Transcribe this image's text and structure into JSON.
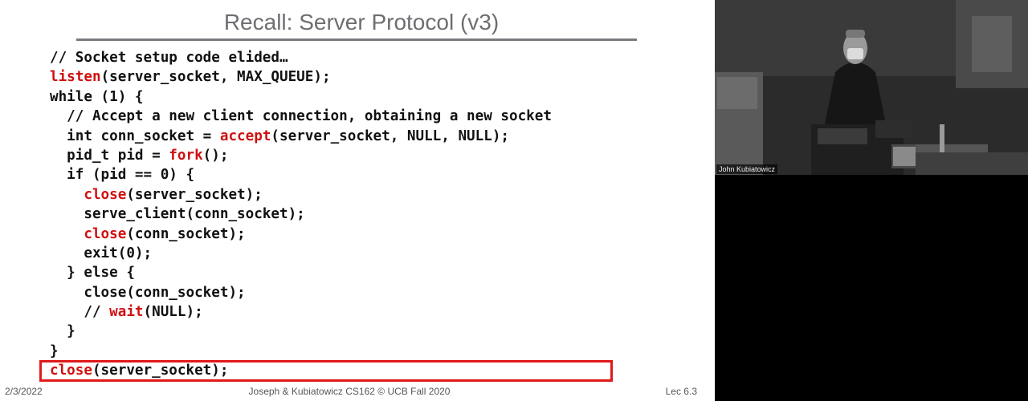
{
  "slide": {
    "title": "Recall: Server Protocol (v3)",
    "code_lines": [
      [
        {
          "t": "// Socket setup code elided…",
          "k": false
        }
      ],
      [
        {
          "t": "listen",
          "k": true
        },
        {
          "t": "(server_socket, MAX_QUEUE);",
          "k": false
        }
      ],
      [
        {
          "t": "while (1) {",
          "k": false
        }
      ],
      [
        {
          "t": "  // Accept a new client connection, obtaining a new socket",
          "k": false
        }
      ],
      [
        {
          "t": "  int conn_socket = ",
          "k": false
        },
        {
          "t": "accept",
          "k": true
        },
        {
          "t": "(server_socket, NULL, NULL);",
          "k": false
        }
      ],
      [
        {
          "t": "  pid_t pid = ",
          "k": false
        },
        {
          "t": "fork",
          "k": true
        },
        {
          "t": "();",
          "k": false
        }
      ],
      [
        {
          "t": "  if (pid == 0) {",
          "k": false
        }
      ],
      [
        {
          "t": "    ",
          "k": false
        },
        {
          "t": "close",
          "k": true
        },
        {
          "t": "(server_socket);",
          "k": false
        }
      ],
      [
        {
          "t": "    serve_client(conn_socket);",
          "k": false
        }
      ],
      [
        {
          "t": "    ",
          "k": false
        },
        {
          "t": "close",
          "k": true
        },
        {
          "t": "(conn_socket);",
          "k": false
        }
      ],
      [
        {
          "t": "    exit(0);",
          "k": false
        }
      ],
      [
        {
          "t": "  } else {",
          "k": false
        }
      ],
      [
        {
          "t": "    close(conn_socket);",
          "k": false
        }
      ],
      [
        {
          "t": "    // ",
          "k": false
        },
        {
          "t": "wait",
          "k": true
        },
        {
          "t": "(NULL);",
          "k": false
        }
      ],
      [
        {
          "t": "  }",
          "k": false
        }
      ],
      [
        {
          "t": "}",
          "k": false
        }
      ],
      [
        {
          "t": "close",
          "k": true
        },
        {
          "t": "(server_socket);",
          "k": false
        }
      ]
    ],
    "footer": {
      "date": "2/3/2022",
      "center": "Joseph & Kubiatowicz CS162 © UCB Fall 2020",
      "lecture": "Lec 6.3"
    }
  },
  "video": {
    "speaker_name": "John Kubiatowicz"
  },
  "colors": {
    "keyword": "#d01010",
    "highlight_box": "#e01a1a",
    "title": "#6e6e72"
  }
}
